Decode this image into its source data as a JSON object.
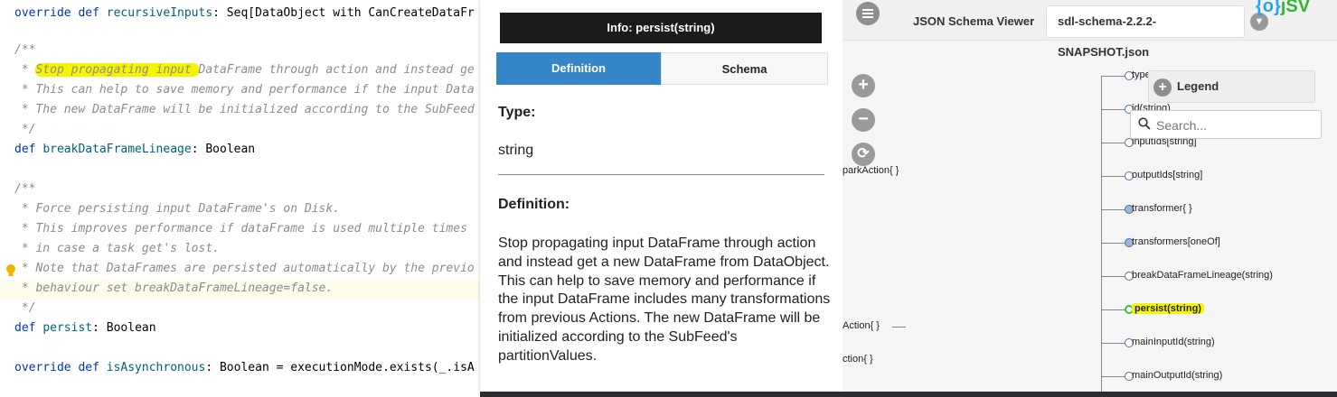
{
  "editor": {
    "lines": {
      "l1_kw": "override def ",
      "l1_fn": "recursiveInputs",
      "l1_rest": ": Seq[DataObject with CanCreateDataFr",
      "l2": "/**",
      "l3_pre": " * ",
      "l3_hl": "Stop propagating input ",
      "l3_post": "DataFrame through action and instead ge",
      "l4": " * This can help to save memory and performance if the input Data",
      "l5": " * The new DataFrame will be initialized according to the SubFeed",
      "l6": " */",
      "l7_kw": "def ",
      "l7_fn": "breakDataFrameLineage",
      "l7_rest": ": Boolean",
      "l8": "/**",
      "l9": " * Force persisting input DataFrame's on Disk.",
      "l10": " * This improves performance if dataFrame is used multiple times",
      "l11": " * in case a task get's lost.",
      "l12": " * Note that DataFrames are persisted automatically by the previo",
      "l13": " * behaviour set breakDataFrameLineage=false.",
      "l14": " */",
      "l15_kw": "def ",
      "l15_fn": "persist",
      "l15_rest": ": Boolean",
      "l16_kw": "override def ",
      "l16_fn": "isAsynchronous",
      "l16_rest": ": Boolean = executionMode.exists(_.isA"
    }
  },
  "info": {
    "title": "Info: persist(string)",
    "tabs": {
      "definition": "Definition",
      "schema": "Schema"
    },
    "type_heading": "Type:",
    "type_value": "string",
    "definition_heading": "Definition:",
    "definition_text": "Stop propagating input DataFrame through action and instead get a new DataFrame from DataObject. This can help to save memory and performance if the input DataFrame includes many transformations from previous Actions. The new DataFrame will be initialized according to the SubFeed's partitionValues."
  },
  "viewer": {
    "title": "JSON Schema Viewer",
    "schema_file": "sdl-schema-2.2.2-SNAPSHOT.json",
    "logo": "jSV",
    "legend_label": "Legend",
    "search_placeholder": "Search...",
    "parent_labels": [
      "parkAction{ }",
      "Action{ }",
      "ction{ }"
    ],
    "nodes": [
      {
        "label": "type",
        "filled": false
      },
      {
        "label": "id(string)",
        "filled": false
      },
      {
        "label": "inputIds[string]",
        "filled": false
      },
      {
        "label": "outputIds[string]",
        "filled": false
      },
      {
        "label": "transformer{ }",
        "filled": true
      },
      {
        "label": "transformers[oneOf]",
        "filled": true
      },
      {
        "label": "breakDataFrameLineage(string)",
        "filled": false
      },
      {
        "label": "persist(string)",
        "filled": false,
        "selected": true
      },
      {
        "label": "mainInputId(string)",
        "filled": false
      },
      {
        "label": "mainOutputId(string)",
        "filled": false
      }
    ]
  }
}
